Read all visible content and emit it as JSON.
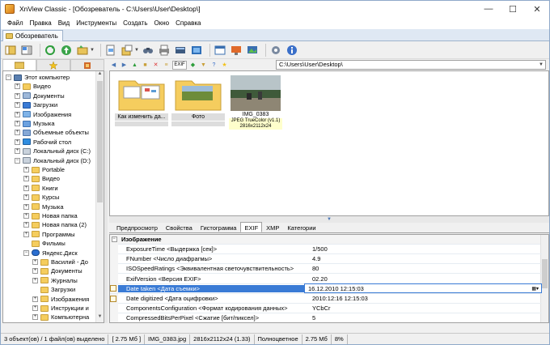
{
  "window": {
    "title": "XnView Classic - [Обозреватель - C:\\Users\\User\\Desktop\\]",
    "controls": [
      "—",
      "☐",
      "✕"
    ]
  },
  "menu": [
    "Файл",
    "Правка",
    "Вид",
    "Инструменты",
    "Создать",
    "Окно",
    "Справка"
  ],
  "doc_tab": "Обозреватель",
  "address": "C:\\Users\\User\\Desktop\\",
  "tree": [
    {
      "label": "Этот компьютер",
      "icon": "pc",
      "indent": 0,
      "exp": "−"
    },
    {
      "label": "Видео",
      "icon": "folder",
      "indent": 1,
      "exp": "+"
    },
    {
      "label": "Документы",
      "icon": "docs",
      "indent": 1,
      "exp": "+"
    },
    {
      "label": "Загрузки",
      "icon": "dl",
      "indent": 1,
      "exp": "+"
    },
    {
      "label": "Изображения",
      "icon": "img",
      "indent": 1,
      "exp": "+"
    },
    {
      "label": "Музыка",
      "icon": "music",
      "indent": 1,
      "exp": "+"
    },
    {
      "label": "Объемные объекты",
      "icon": "obj",
      "indent": 1,
      "exp": "+"
    },
    {
      "label": "Рабочий стол",
      "icon": "desk",
      "indent": 1,
      "exp": "+"
    },
    {
      "label": "Локальный диск (C:)",
      "icon": "drive",
      "indent": 1,
      "exp": "+"
    },
    {
      "label": "Локальный диск (D:)",
      "icon": "drive",
      "indent": 1,
      "exp": "−"
    },
    {
      "label": "Portable",
      "icon": "folder",
      "indent": 2,
      "exp": "+"
    },
    {
      "label": "Видео",
      "icon": "folder",
      "indent": 2,
      "exp": "+"
    },
    {
      "label": "Книги",
      "icon": "folder",
      "indent": 2,
      "exp": "+"
    },
    {
      "label": "Курсы",
      "icon": "folder",
      "indent": 2,
      "exp": "+"
    },
    {
      "label": "Музыка",
      "icon": "folder",
      "indent": 2,
      "exp": "+"
    },
    {
      "label": "Новая папка",
      "icon": "folder",
      "indent": 2,
      "exp": "+"
    },
    {
      "label": "Новая папка (2)",
      "icon": "folder",
      "indent": 2,
      "exp": "+"
    },
    {
      "label": "Программы",
      "icon": "folder",
      "indent": 2,
      "exp": "+"
    },
    {
      "label": "Фильмы",
      "icon": "folder",
      "indent": 2,
      "exp": ""
    },
    {
      "label": "Яндекс.Диск",
      "icon": "yd",
      "indent": 2,
      "exp": "−"
    },
    {
      "label": "Василий - До",
      "icon": "folder",
      "indent": 3,
      "exp": "+"
    },
    {
      "label": "Документы",
      "icon": "folder",
      "indent": 3,
      "exp": "+"
    },
    {
      "label": "Журналы",
      "icon": "folder",
      "indent": 3,
      "exp": "+"
    },
    {
      "label": "Загрузки",
      "icon": "folder",
      "indent": 3,
      "exp": ""
    },
    {
      "label": "Изображения",
      "icon": "folder",
      "indent": 3,
      "exp": "+"
    },
    {
      "label": "Инструкции и",
      "icon": "folder",
      "indent": 3,
      "exp": "+"
    },
    {
      "label": "Компьютерна",
      "icon": "folder",
      "indent": 3,
      "exp": "+"
    }
  ],
  "thumbnails": [
    {
      "caption": "Как изменить да...",
      "kind": "folder"
    },
    {
      "caption": "Фото",
      "kind": "folder"
    },
    {
      "caption": "IMG_0383",
      "kind": "image",
      "info1": "JPEG TrueColor (v1.1)",
      "info2": "2816x2112x24"
    }
  ],
  "prop_tabs": [
    "Предпросмотр",
    "Свойства",
    "Гистограмма",
    "EXIF",
    "XMP",
    "Категории"
  ],
  "exif_group": "Изображение",
  "exif_rows": [
    {
      "key": "ExposureTime <Выдержка [сек]>",
      "value": "1/500"
    },
    {
      "key": "FNumber <Число диафрагмы>",
      "value": "4.9"
    },
    {
      "key": "ISOSpeedRatings <Эквивалентная светочувствительность>",
      "value": "80"
    },
    {
      "key": "ExifVersion <Версия EXIF>",
      "value": "02.20"
    },
    {
      "key": "Date taken <Дата съемки>",
      "value": "16.12.2010 12:15:03"
    },
    {
      "key": "Date digitized <Дата оцифровки>",
      "value": "2010:12:16 12:15:03"
    },
    {
      "key": "ComponentsConfiguration <Формат кодирования данных>",
      "value": "YCbCr"
    },
    {
      "key": "CompressedBitsPerPixel <Сжатие [бит/пиксел]>",
      "value": "5"
    }
  ],
  "status": [
    "3 объект(ов) / 1 файл(ов) выделено",
    "[ 2.75 Мб ]",
    "IMG_0383.jpg",
    "2816x2112x24 (1.33)",
    "Полноцветное",
    "2.75 Мб",
    "8%"
  ]
}
